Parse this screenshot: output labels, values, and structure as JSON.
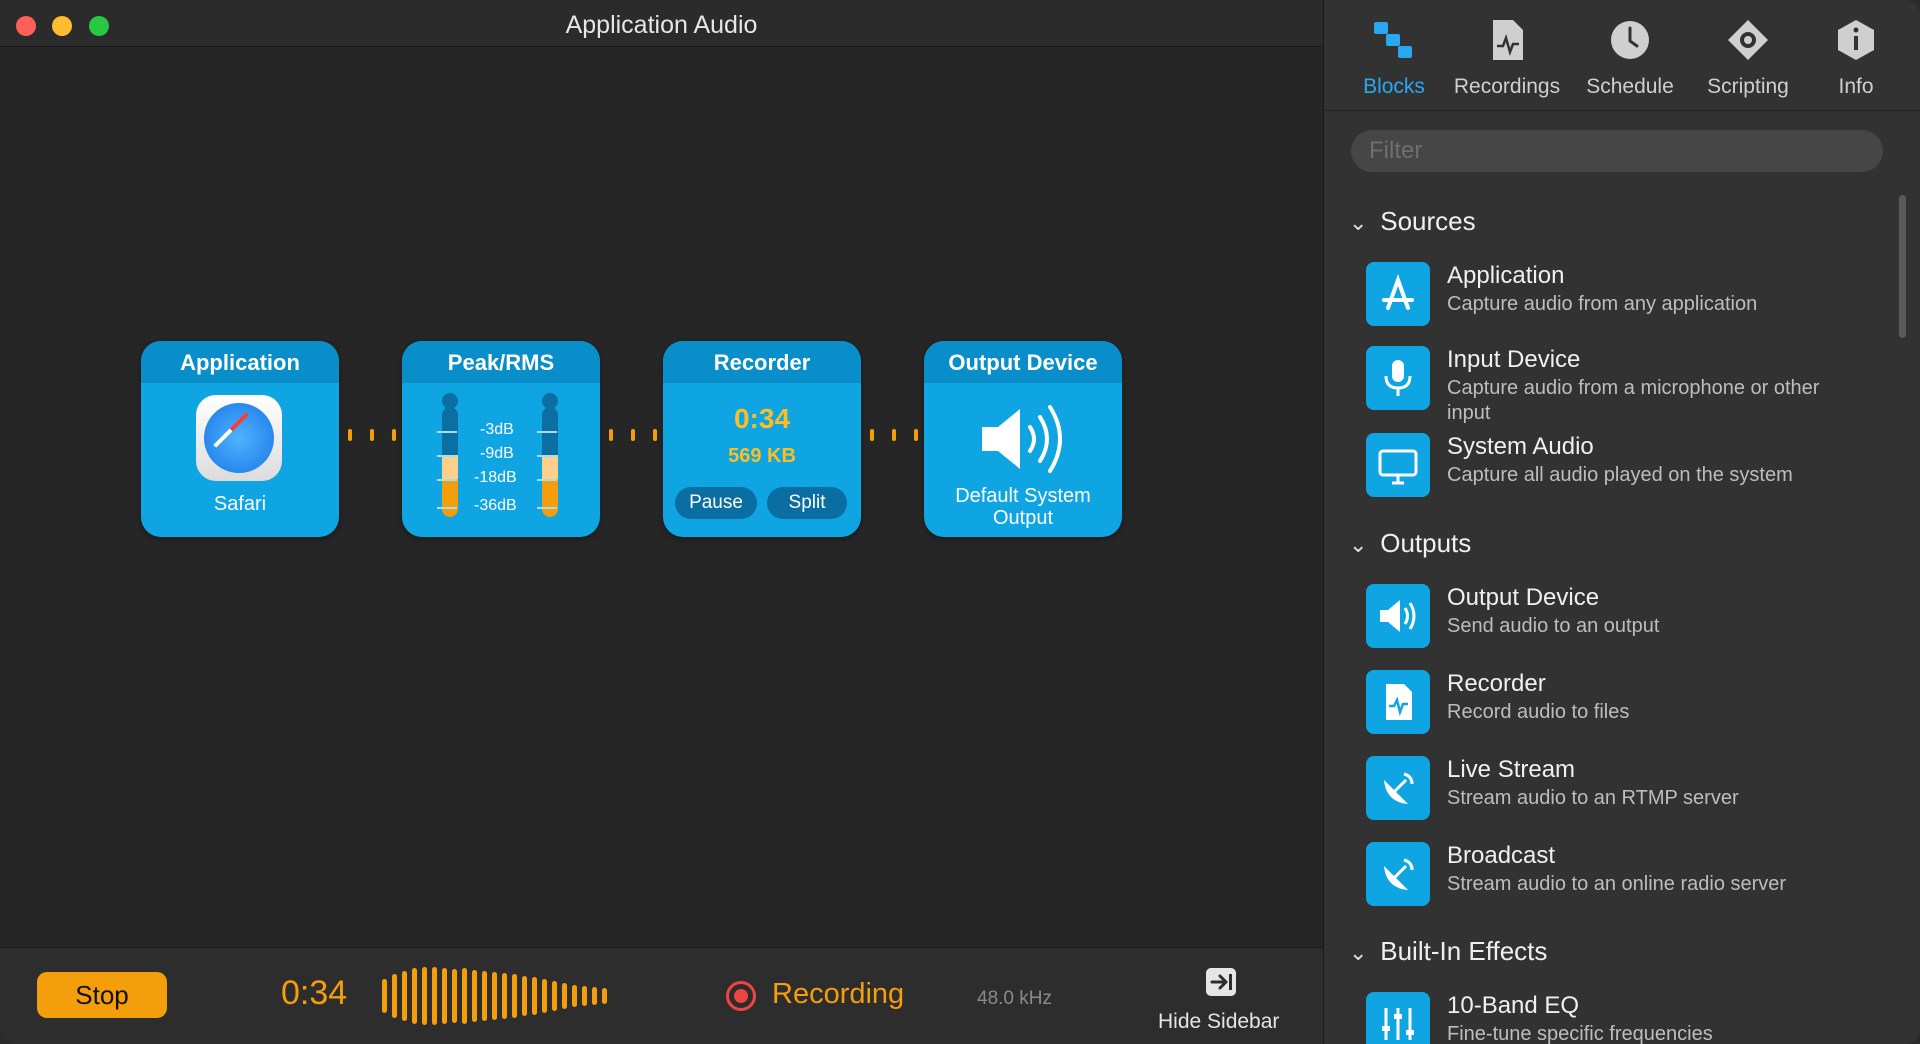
{
  "window": {
    "title": "Application Audio"
  },
  "blocks": {
    "application": {
      "title": "Application",
      "caption": "Safari"
    },
    "meter": {
      "title": "Peak/RMS",
      "db_labels": [
        "-3dB",
        "-9dB",
        "-18dB",
        "-36dB"
      ]
    },
    "recorder": {
      "title": "Recorder",
      "time": "0:34",
      "size": "569 KB",
      "pause": "Pause",
      "split": "Split"
    },
    "output": {
      "title": "Output Device",
      "caption": "Default System Output"
    }
  },
  "bottombar": {
    "stop": "Stop",
    "elapsed": "0:34",
    "status": "Recording",
    "sample_rate": "48.0 kHz",
    "hide_sidebar": "Hide Sidebar"
  },
  "sidebar": {
    "tabs": [
      {
        "label": "Blocks",
        "icon": "blocks-icon",
        "active": true
      },
      {
        "label": "Recordings",
        "icon": "recordings-icon"
      },
      {
        "label": "Schedule",
        "icon": "clock-icon"
      },
      {
        "label": "Scripting",
        "icon": "scripting-icon"
      },
      {
        "label": "Info",
        "icon": "info-icon"
      }
    ],
    "filter_placeholder": "Filter",
    "sections": {
      "sources": "Sources",
      "outputs": "Outputs",
      "effects": "Built-In Effects"
    },
    "items": {
      "application": {
        "name": "Application",
        "desc": "Capture audio from any application"
      },
      "input_device": {
        "name": "Input Device",
        "desc": "Capture audio from a microphone or other input"
      },
      "system_audio": {
        "name": "System Audio",
        "desc": "Capture all audio played on the system"
      },
      "output_device": {
        "name": "Output Device",
        "desc": "Send audio to an output"
      },
      "recorder": {
        "name": "Recorder",
        "desc": "Record audio to files"
      },
      "live_stream": {
        "name": "Live Stream",
        "desc": "Stream audio to an RTMP server"
      },
      "broadcast": {
        "name": "Broadcast",
        "desc": "Stream audio to an online radio server"
      },
      "eq": {
        "name": "10-Band EQ",
        "desc": "Fine-tune specific frequencies"
      }
    }
  },
  "colors": {
    "accent": "#0ea5e2",
    "orange": "#f59e0b",
    "record_red": "#ef4444",
    "tab_active": "#2aa8ef"
  }
}
